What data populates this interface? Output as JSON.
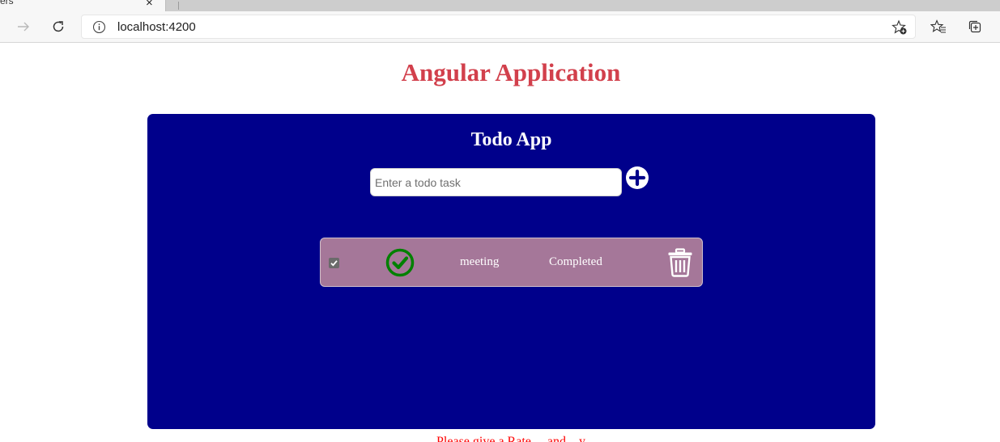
{
  "browser": {
    "tab_title": "ers",
    "tab_close_glyph": "×",
    "address": "localhost:4200",
    "icons": [
      "forward-icon",
      "refresh-icon",
      "info-icon",
      "add-favorite-icon",
      "favorites-icon",
      "collections-icon"
    ]
  },
  "page": {
    "title": "Angular Application",
    "title_color": "#d2404c",
    "footer_text": "Please give a Rate..., and... y"
  },
  "todo_app": {
    "title": "Todo App",
    "input": {
      "value": "",
      "placeholder": "Enter a todo task"
    },
    "panel_color": "#00008b",
    "item_color": "#a57799",
    "items": [
      {
        "text": "meeting",
        "status": "Completed",
        "checked": true,
        "icon": "check-circle-icon"
      }
    ]
  }
}
